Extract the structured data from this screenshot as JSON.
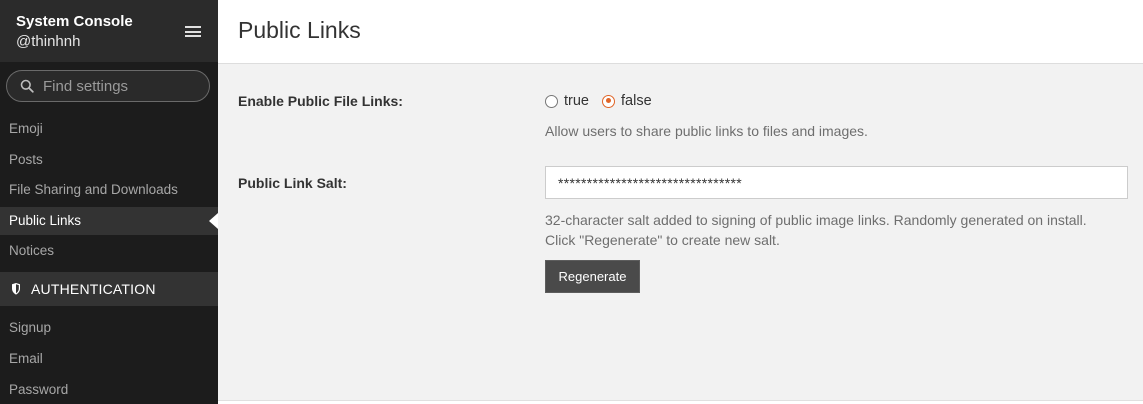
{
  "sidebar": {
    "title": "System Console",
    "user": "@thinhnh",
    "search_placeholder": "Find settings",
    "items": [
      {
        "label": "Emoji"
      },
      {
        "label": "Posts"
      },
      {
        "label": "File Sharing and Downloads"
      },
      {
        "label": "Public Links"
      },
      {
        "label": "Notices"
      }
    ],
    "section": {
      "label": "AUTHENTICATION"
    },
    "auth_items": [
      {
        "label": "Signup"
      },
      {
        "label": "Email"
      },
      {
        "label": "Password"
      }
    ]
  },
  "main": {
    "title": "Public Links",
    "public_file_links": {
      "label": "Enable Public File Links:",
      "option_true": "true",
      "option_false": "false",
      "selected": "false",
      "help": "Allow users to share public links to files and images."
    },
    "public_link_salt": {
      "label": "Public Link Salt:",
      "value": "********************************",
      "help_line1": "32-character salt added to signing of public image links. Randomly generated on install.",
      "help_line2": "Click \"Regenerate\" to create new salt.",
      "button": "Regenerate"
    }
  },
  "colors": {
    "accent": "#e06528",
    "sidebar_bg": "#1c1c1c",
    "sidebar_active": "#333333"
  }
}
